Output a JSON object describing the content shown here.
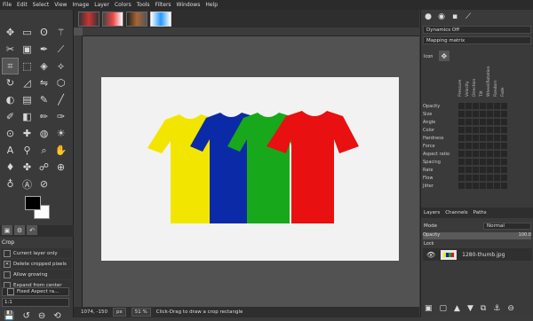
{
  "menubar": [
    "File",
    "Edit",
    "Select",
    "View",
    "Image",
    "Layer",
    "Colors",
    "Tools",
    "Filters",
    "Windows",
    "Help"
  ],
  "toolbox": {
    "tool_icons": [
      "move",
      "rect-select",
      "lasso",
      "fuzzy-select",
      "crop",
      "rotate",
      "warp",
      "flip",
      "text",
      "heal",
      "clone",
      "paint",
      "bucket",
      "gradient",
      "pencil",
      "brush",
      "smudge",
      "dodge",
      "eraser",
      "airbrush",
      "ink",
      "mypaint",
      "blur",
      "color-picker",
      "measure",
      "zoom",
      "path",
      "foreground-select",
      "scissors",
      "hand",
      "unified-transform",
      "handle-transform"
    ],
    "active_tool": "crop",
    "options_title": "Crop",
    "options": [
      {
        "label": "Current layer only",
        "checked": false
      },
      {
        "label": "Delete cropped pixels",
        "checked": true
      },
      {
        "label": "Allow growing",
        "checked": false
      },
      {
        "label": "Expand from center",
        "checked": false
      }
    ],
    "fixed_label": "Fixed Aspect ra...",
    "ratio_value": "1:1"
  },
  "status": {
    "coords": "1074, -150",
    "unit": "px",
    "zoom": "51 %",
    "message": "Click-Drag to draw a crop rectangle"
  },
  "dock": {
    "dynamics": "Dynamics Off",
    "mapping": "Mapping matrix",
    "icon_label": "Icon",
    "columns": [
      "Pressure",
      "Velocity",
      "Direction",
      "Tilt",
      "Wheel/Rotation",
      "Random",
      "Fade"
    ],
    "rows": [
      "Opacity",
      "Size",
      "Angle",
      "Color",
      "Hardness",
      "Force",
      "Aspect ratio",
      "Spacing",
      "Rate",
      "Flow",
      "Jitter"
    ],
    "tabs": [
      "Layers",
      "Channels",
      "Paths"
    ],
    "mode_label": "Mode",
    "mode_value": "Normal",
    "opacity_label": "Opacity",
    "opacity_value": "100.0",
    "lock_label": "Lock",
    "layer_name": "1280-thumb.jpg"
  },
  "image_colors": {
    "yellow": "#f2e600",
    "blue": "#0b2aa8",
    "green": "#17a81c",
    "red": "#e81010"
  }
}
